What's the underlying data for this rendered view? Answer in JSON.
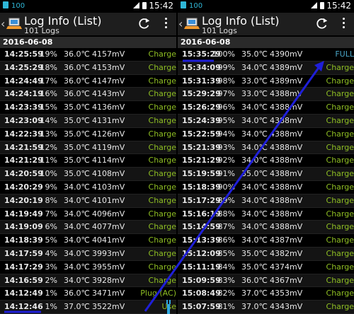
{
  "left": {
    "status": {
      "sim": "100",
      "time": "15:42"
    },
    "header": {
      "title": "Log Info (List)",
      "subtitle": "101 Logs"
    },
    "date": "2016-06-08",
    "rows": [
      {
        "time": "14:25:59",
        "pct": "19%",
        "temp": "36.0℃",
        "mv": "4157mV",
        "state": "Charge"
      },
      {
        "time": "14:25:29",
        "pct": "18%",
        "temp": "36.0℃",
        "mv": "4153mV",
        "state": "Charge"
      },
      {
        "time": "14:24:49",
        "pct": "17%",
        "temp": "36.0℃",
        "mv": "4147mV",
        "state": "Charge"
      },
      {
        "time": "14:24:19",
        "pct": "16%",
        "temp": "36.0℃",
        "mv": "4143mV",
        "state": "Charge"
      },
      {
        "time": "14:23:39",
        "pct": "15%",
        "temp": "35.0℃",
        "mv": "4136mV",
        "state": "Charge"
      },
      {
        "time": "14:23:09",
        "pct": "14%",
        "temp": "35.0℃",
        "mv": "4131mV",
        "state": "Charge"
      },
      {
        "time": "14:22:39",
        "pct": "13%",
        "temp": "35.0℃",
        "mv": "4126mV",
        "state": "Charge"
      },
      {
        "time": "14:21:59",
        "pct": "12%",
        "temp": "35.0℃",
        "mv": "4119mV",
        "state": "Charge"
      },
      {
        "time": "14:21:29",
        "pct": "11%",
        "temp": "35.0℃",
        "mv": "4114mV",
        "state": "Charge"
      },
      {
        "time": "14:20:59",
        "pct": "10%",
        "temp": "35.0℃",
        "mv": "4108mV",
        "state": "Charge"
      },
      {
        "time": "14:20:29",
        "pct": "9%",
        "temp": "34.0℃",
        "mv": "4103mV",
        "state": "Charge"
      },
      {
        "time": "14:20:19",
        "pct": "8%",
        "temp": "34.0℃",
        "mv": "4101mV",
        "state": "Charge"
      },
      {
        "time": "14:19:49",
        "pct": "7%",
        "temp": "34.0℃",
        "mv": "4096mV",
        "state": "Charge"
      },
      {
        "time": "14:19:09",
        "pct": "6%",
        "temp": "34.0℃",
        "mv": "4077mV",
        "state": "Charge"
      },
      {
        "time": "14:18:39",
        "pct": "5%",
        "temp": "34.0℃",
        "mv": "4041mV",
        "state": "Charge"
      },
      {
        "time": "14:17:59",
        "pct": "4%",
        "temp": "34.0℃",
        "mv": "3993mV",
        "state": "Charge"
      },
      {
        "time": "14:17:29",
        "pct": "3%",
        "temp": "34.0℃",
        "mv": "3955mV",
        "state": "Charge"
      },
      {
        "time": "14:16:59",
        "pct": "2%",
        "temp": "34.0℃",
        "mv": "3928mV",
        "state": "Charge"
      },
      {
        "time": "14:12:49",
        "pct": "1%",
        "temp": "36.0℃",
        "mv": "3471mV",
        "state": "Plug (AC)"
      },
      {
        "time": "14:12:46",
        "pct": "1%",
        "temp": "37.0℃",
        "mv": "3522mV",
        "state": "Use"
      }
    ]
  },
  "right": {
    "status": {
      "sim": "100",
      "time": "15:42"
    },
    "header": {
      "title": "Log Info (List)",
      "subtitle": "101 Logs"
    },
    "date": "2016-06-08",
    "rows": [
      {
        "time": "15:35:29",
        "pct": "100%",
        "temp": "35.0℃",
        "mv": "4390mV",
        "state": "FULL"
      },
      {
        "time": "15:34:09",
        "pct": "99%",
        "temp": "34.0℃",
        "mv": "4389mV",
        "state": "Charge"
      },
      {
        "time": "15:31:39",
        "pct": "98%",
        "temp": "33.0℃",
        "mv": "4389mV",
        "state": "Charge"
      },
      {
        "time": "15:29:29",
        "pct": "97%",
        "temp": "33.0℃",
        "mv": "4388mV",
        "state": "Charge"
      },
      {
        "time": "15:26:29",
        "pct": "96%",
        "temp": "34.0℃",
        "mv": "4388mV",
        "state": "Charge"
      },
      {
        "time": "15:24:39",
        "pct": "95%",
        "temp": "34.0℃",
        "mv": "4388mV",
        "state": "Charge"
      },
      {
        "time": "15:22:59",
        "pct": "94%",
        "temp": "34.0℃",
        "mv": "4388mV",
        "state": "Charge"
      },
      {
        "time": "15:21:39",
        "pct": "93%",
        "temp": "34.0℃",
        "mv": "4388mV",
        "state": "Charge"
      },
      {
        "time": "15:21:29",
        "pct": "92%",
        "temp": "34.0℃",
        "mv": "4388mV",
        "state": "Charge"
      },
      {
        "time": "15:19:59",
        "pct": "91%",
        "temp": "35.0℃",
        "mv": "4388mV",
        "state": "Charge"
      },
      {
        "time": "15:18:39",
        "pct": "90%",
        "temp": "34.0℃",
        "mv": "4388mV",
        "state": "Charge"
      },
      {
        "time": "15:17:29",
        "pct": "89%",
        "temp": "34.0℃",
        "mv": "4388mV",
        "state": "Charge"
      },
      {
        "time": "15:16:19",
        "pct": "88%",
        "temp": "34.0℃",
        "mv": "4388mV",
        "state": "Charge"
      },
      {
        "time": "15:14:59",
        "pct": "87%",
        "temp": "34.0℃",
        "mv": "4388mV",
        "state": "Charge"
      },
      {
        "time": "15:13:39",
        "pct": "86%",
        "temp": "34.0℃",
        "mv": "4387mV",
        "state": "Charge"
      },
      {
        "time": "15:12:09",
        "pct": "85%",
        "temp": "35.0℃",
        "mv": "4382mV",
        "state": "Charge"
      },
      {
        "time": "15:11:19",
        "pct": "84%",
        "temp": "35.0℃",
        "mv": "4374mV",
        "state": "Charge"
      },
      {
        "time": "15:09:59",
        "pct": "83%",
        "temp": "36.0℃",
        "mv": "4367mV",
        "state": "Charge"
      },
      {
        "time": "15:08:49",
        "pct": "82%",
        "temp": "37.0℃",
        "mv": "4353mV",
        "state": "Charge"
      },
      {
        "time": "15:07:59",
        "pct": "81%",
        "temp": "37.0℃",
        "mv": "4343mV",
        "state": "Charge"
      }
    ]
  },
  "colors": {
    "charge": "#8fbf23",
    "full": "#4aa6c8",
    "annotation": "#1f1fd8"
  }
}
